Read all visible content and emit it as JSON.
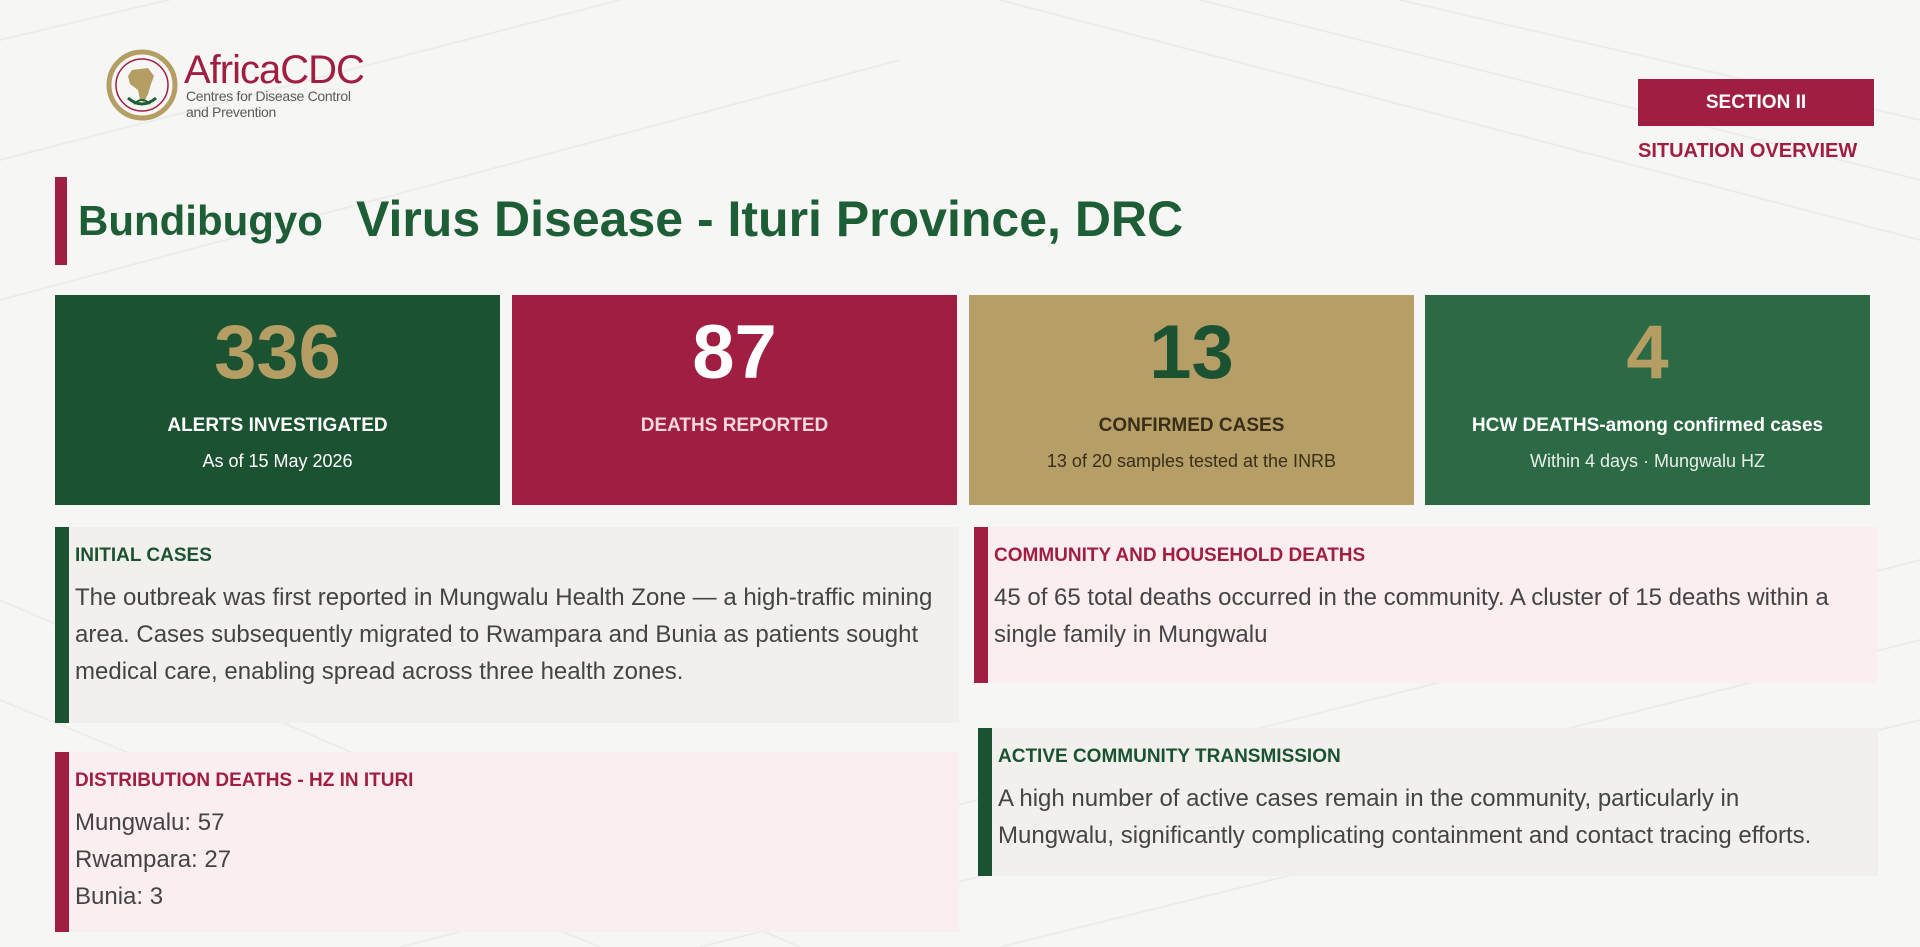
{
  "logo": {
    "title": "AfricaCDC",
    "subtitle": "Centres for Disease Control and Prevention"
  },
  "section": {
    "badge": "SECTION II",
    "subtitle": "SITUATION OVERVIEW"
  },
  "title": {
    "part1": "Bundibugyo",
    "part2": "Virus Disease - Ituri Province, DRC"
  },
  "stats": [
    {
      "value": "336",
      "label": "ALERTS INVESTIGATED",
      "sub": "As of 15 May 2026"
    },
    {
      "value": "87",
      "label": "DEATHS REPORTED",
      "sub": ""
    },
    {
      "value": "13",
      "label": "CONFIRMED CASES",
      "sub": "13 of 20 samples tested at the INRB"
    },
    {
      "value": "4",
      "label": "HCW DEATHS-among confirmed cases",
      "sub": "Within 4 days · Mungwalu HZ"
    }
  ],
  "boxes": {
    "initial": {
      "title": "INITIAL CASES",
      "body": "The outbreak was first reported  in Mungwalu Health Zone — a high-traffic mining area. Cases subsequently migrated to Rwampara and Bunia as patients sought medical care, enabling spread across three health zones."
    },
    "community": {
      "title": "COMMUNITY AND HOUSEHOLD DEATHS",
      "body": "45 of 65 total deaths occurred in the community. A cluster of 15 deaths within a single family in Mungwalu"
    },
    "distribution": {
      "title": "DISTRIBUTION DEATHS - HZ IN ITURI",
      "items": [
        "Mungwalu: 57",
        "Rwampara: 27",
        "Bunia: 3"
      ]
    },
    "transmission": {
      "title": "ACTIVE COMMUNITY TRANSMISSION",
      "body": "A high number of active cases remain in the community, particularly in Mungwalu, significantly complicating containment and contact tracing efforts."
    }
  },
  "colors": {
    "primary_green": "#1b5332",
    "secondary_green": "#2b6a45",
    "crimson": "#a01e42",
    "gold": "#b59f67"
  }
}
